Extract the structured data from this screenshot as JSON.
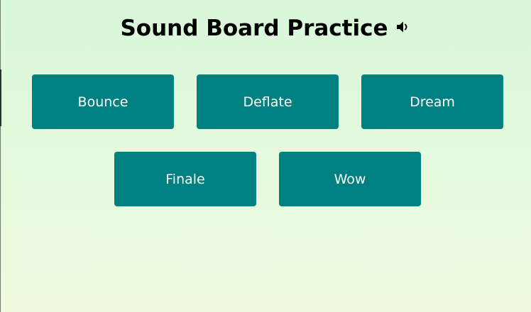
{
  "header": {
    "title": "Sound Board Practice",
    "icon": "speaker-icon"
  },
  "buttons": [
    {
      "label": "Bounce"
    },
    {
      "label": "Deflate"
    },
    {
      "label": "Dream"
    },
    {
      "label": "Finale"
    },
    {
      "label": "Wow"
    }
  ],
  "colors": {
    "button_bg": "#008080",
    "button_text": "#ffffff",
    "title_text": "#000000",
    "background_top": "#d9f7da",
    "background_bottom": "#eefade"
  }
}
